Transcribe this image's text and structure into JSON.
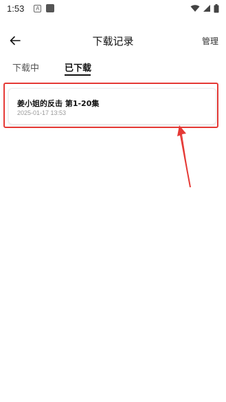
{
  "status_bar": {
    "time": "1:53",
    "notification_letter": "A"
  },
  "header": {
    "title": "下载记录",
    "manage_label": "管理"
  },
  "tabs": [
    {
      "label": "下载中",
      "active": false
    },
    {
      "label": "已下载",
      "active": true
    }
  ],
  "downloads": [
    {
      "title": "姜小姐的反击 第1-20集",
      "date": "2025-01-17 13:53"
    }
  ],
  "colors": {
    "annotation": "#e53935",
    "text_primary": "#111111",
    "text_secondary": "#999999"
  }
}
